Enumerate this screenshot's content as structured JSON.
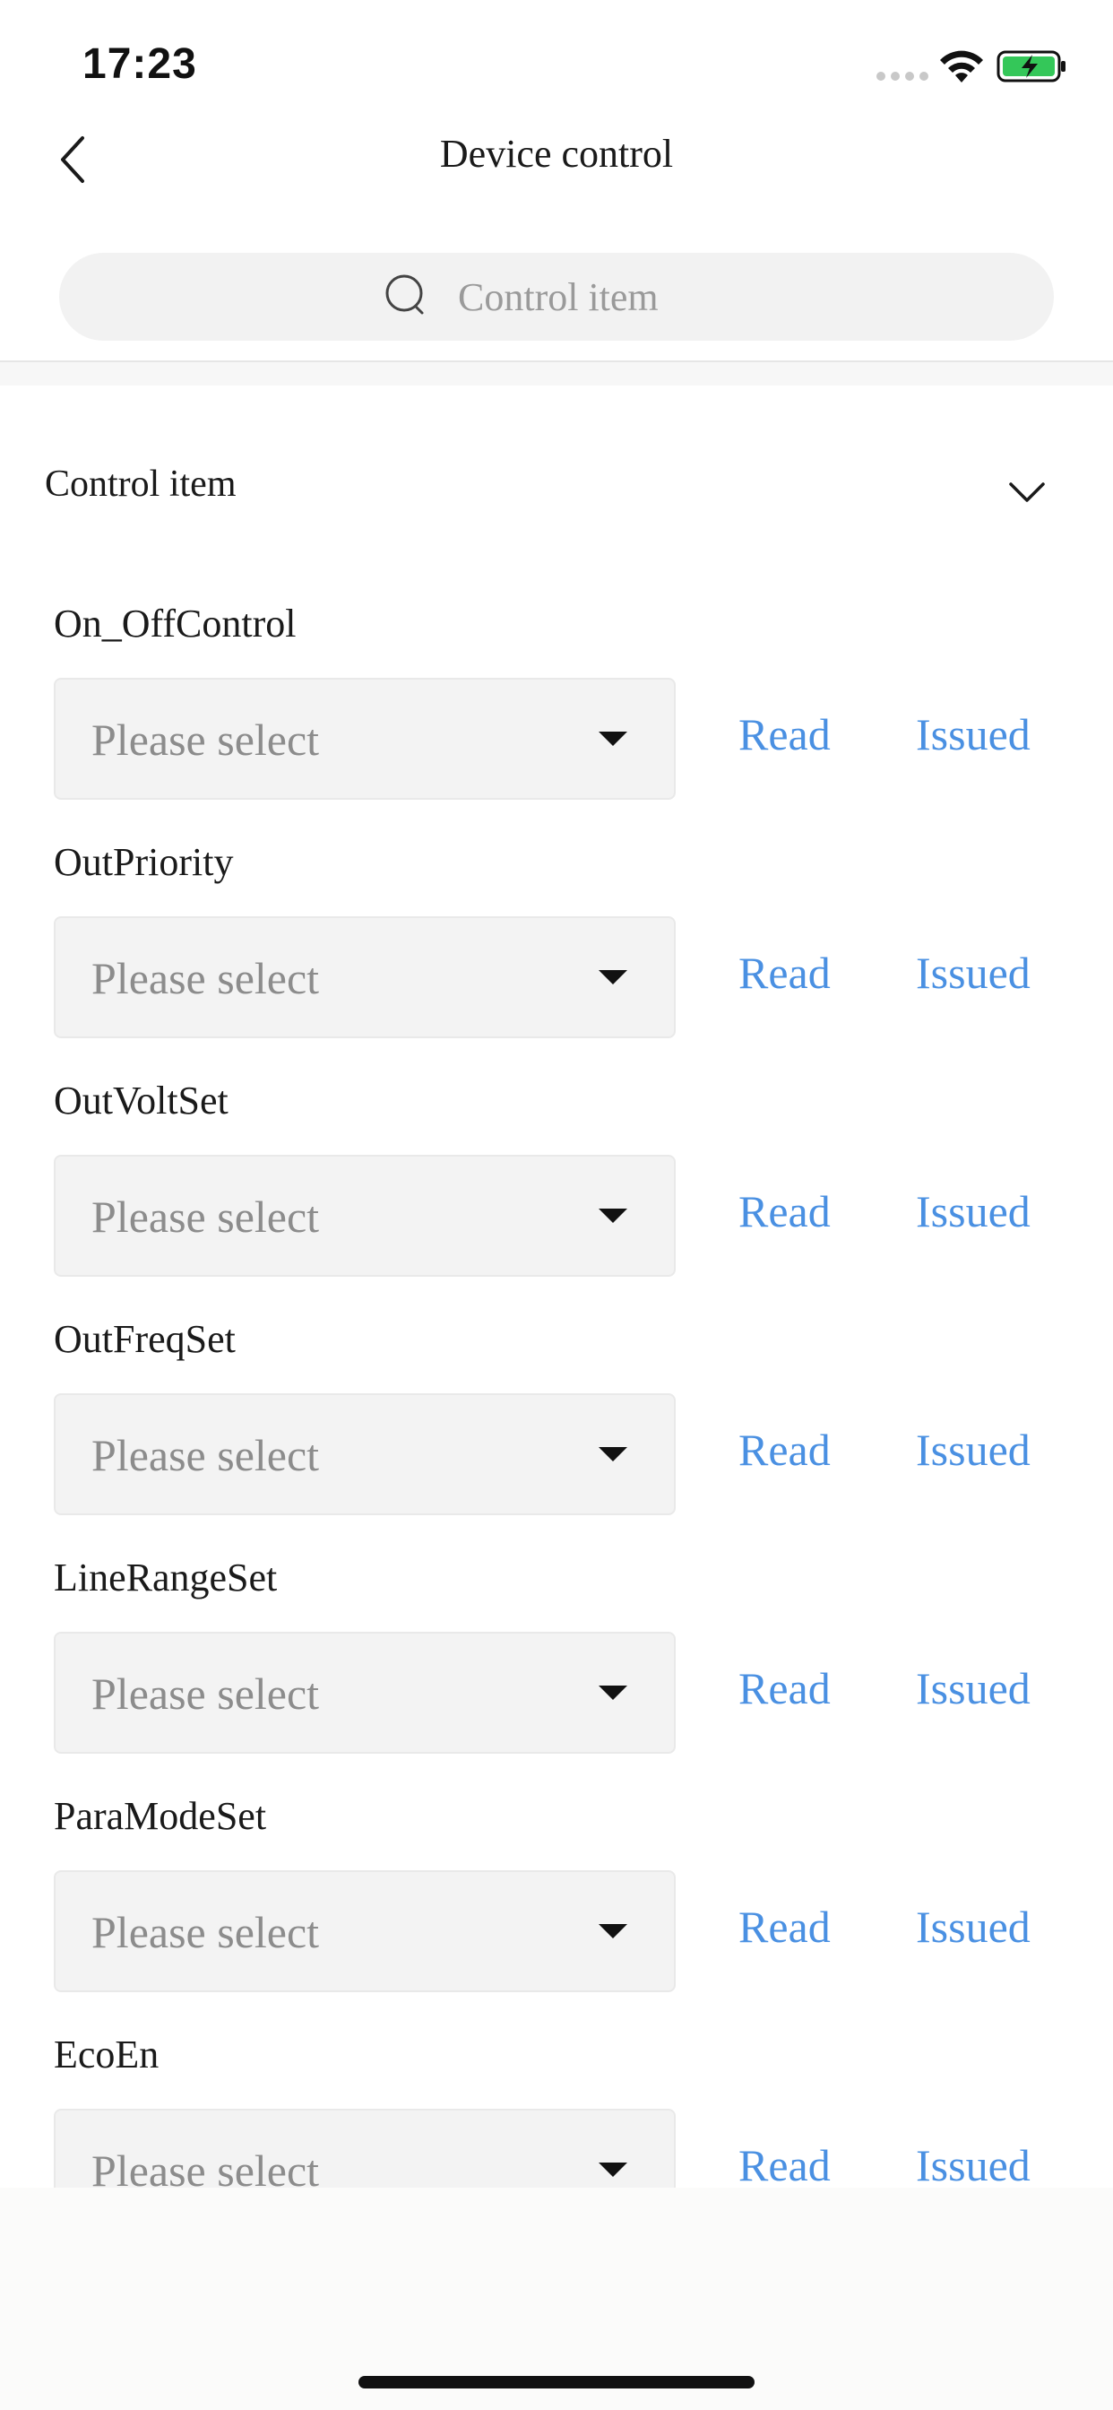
{
  "status_bar": {
    "time": "17:23",
    "battery_color": "#34c759"
  },
  "nav": {
    "title": "Device control",
    "back_icon": "chevron-left-icon"
  },
  "search": {
    "placeholder": "Control item",
    "icon": "search-icon"
  },
  "section": {
    "title": "Control item",
    "chevron_icon": "chevron-down-icon"
  },
  "controls": [
    {
      "label": "On_OffControl",
      "placeholder": "Please select",
      "read": "Read",
      "issued": "Issued"
    },
    {
      "label": "OutPriority",
      "placeholder": "Please select",
      "read": "Read",
      "issued": "Issued"
    },
    {
      "label": "OutVoltSet",
      "placeholder": "Please select",
      "read": "Read",
      "issued": "Issued"
    },
    {
      "label": "OutFreqSet",
      "placeholder": "Please select",
      "read": "Read",
      "issued": "Issued"
    },
    {
      "label": "LineRangeSet",
      "placeholder": "Please select",
      "read": "Read",
      "issued": "Issued"
    },
    {
      "label": "ParaModeSet",
      "placeholder": "Please select",
      "read": "Read",
      "issued": "Issued"
    },
    {
      "label": "EcoEn",
      "placeholder": "Please select",
      "read": "Read",
      "issued": "Issued"
    }
  ],
  "colors": {
    "accent": "#4a90e2",
    "field_background": "#f3f3f3",
    "placeholder_text": "#8c8c8c"
  }
}
